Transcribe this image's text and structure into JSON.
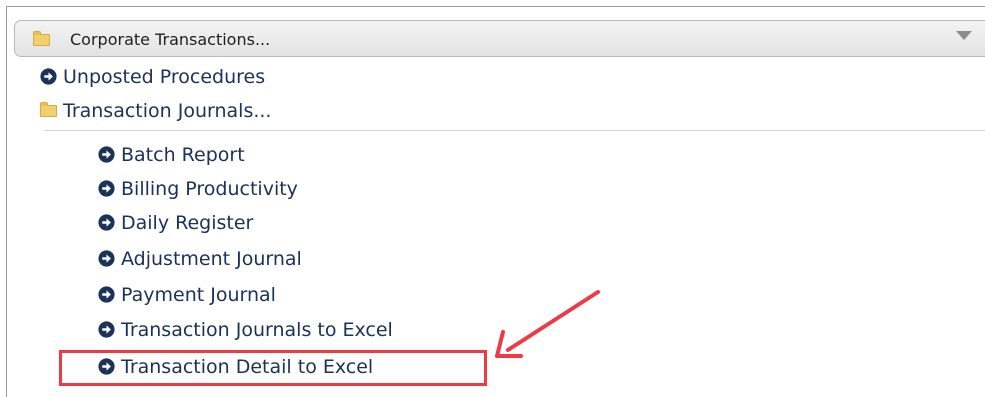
{
  "header": {
    "title": "Corporate Transactions..."
  },
  "menu": {
    "unposted": "Unposted Procedures",
    "journals_folder": "Transaction Journals...",
    "journal_items": [
      "Batch Report",
      "Billing Productivity",
      "Daily Register",
      "Adjustment Journal",
      "Payment Journal",
      "Transaction Journals to Excel",
      "Transaction Detail to Excel"
    ]
  },
  "colors": {
    "link_text": "#18325a",
    "icon_fill": "#1b3358",
    "annotation": "#ee3a45"
  }
}
